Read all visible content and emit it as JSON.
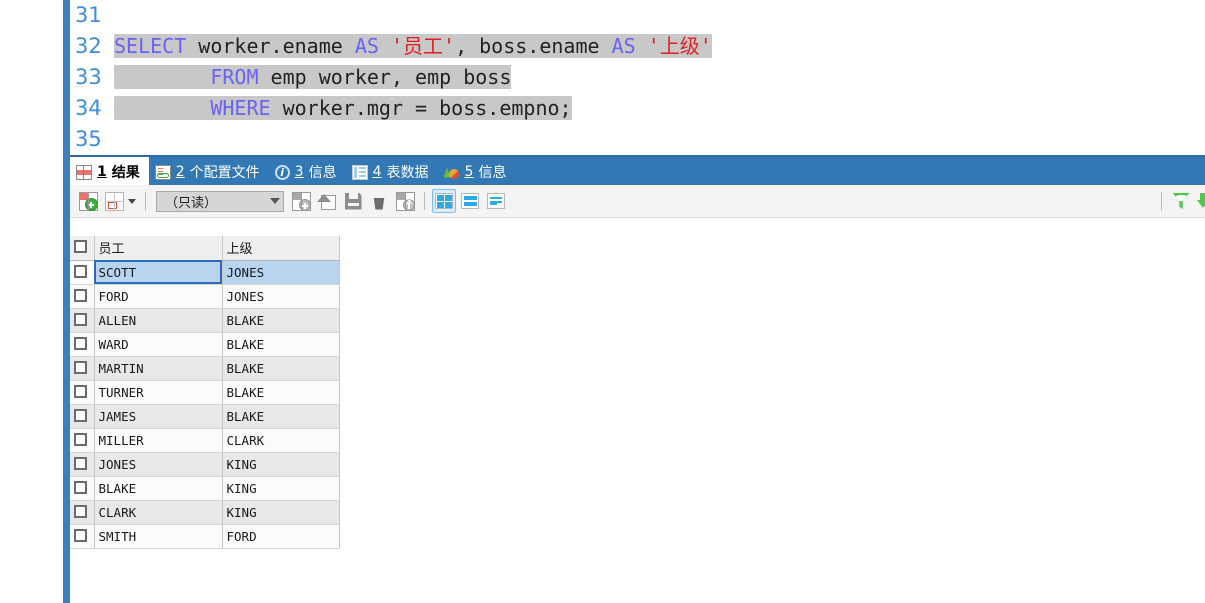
{
  "editor": {
    "line_numbers": [
      "31",
      "32",
      "33",
      "34",
      "35"
    ],
    "lines": [
      {
        "n": "31",
        "text": ""
      },
      {
        "n": "32",
        "text": "SELECT worker.ename AS '员工', boss.ename AS '上级'"
      },
      {
        "n": "33",
        "text": "        FROM emp worker, emp boss"
      },
      {
        "n": "34",
        "text": "        WHERE worker.mgr = boss.empno;"
      },
      {
        "n": "35",
        "text": ""
      }
    ],
    "tokens": {
      "select": "SELECT",
      "from": "FROM",
      "where": "WHERE",
      "as1": "AS",
      "as2": "AS",
      "worker_ename": " worker.ename ",
      "str1": "'员工'",
      "mid": ", boss.ename ",
      "str2": "'上级'",
      "from_rest": " emp worker, emp boss",
      "where_rest": " worker.mgr = boss.empno;",
      "indent": "        "
    },
    "colors": {
      "keyword": "#6a63f2",
      "string": "#e02020",
      "plain": "#222222",
      "selection_bg": "#c8c8c8",
      "line_number": "#3c8dde"
    }
  },
  "tabbar": {
    "background": "#3178b4",
    "tabs": [
      {
        "num": "1",
        "label": "结果",
        "icon": "results-grid-icon",
        "active": true
      },
      {
        "num": "2",
        "label": "个配置文件",
        "icon": "profile-icon",
        "active": false
      },
      {
        "num": "3",
        "label": "信息",
        "icon": "info-icon",
        "active": false
      },
      {
        "num": "4",
        "label": "表数据",
        "icon": "table-data-icon",
        "active": false
      },
      {
        "num": "5",
        "label": "信息",
        "icon": "chart-icon",
        "active": false
      }
    ]
  },
  "gridbar": {
    "readonly_value": "（只读）",
    "buttons": [
      {
        "name": "add-record-button",
        "icon": "grid-add-icon"
      },
      {
        "name": "grid-options-button",
        "icon": "grid-select-icon"
      },
      {
        "name": "insert-record-button",
        "icon": "grid-plus-icon"
      },
      {
        "name": "refresh-button",
        "icon": "refresh-icon"
      },
      {
        "name": "save-button",
        "icon": "floppy-icon"
      },
      {
        "name": "delete-button",
        "icon": "trash-icon"
      },
      {
        "name": "cancel-button",
        "icon": "grid-cancel-icon"
      },
      {
        "name": "view-grid-button",
        "icon": "view-grid-icon"
      },
      {
        "name": "view-form-button",
        "icon": "view-form-icon"
      },
      {
        "name": "view-text-button",
        "icon": "view-text-icon"
      },
      {
        "name": "filter-button",
        "icon": "funnel-icon"
      },
      {
        "name": "sort-button",
        "icon": "sort-descending-icon"
      }
    ]
  },
  "grid": {
    "columns": [
      "员工",
      "上级"
    ],
    "selected_column_index": 0,
    "selected_row_index": 0,
    "rows": [
      [
        "SCOTT",
        "JONES"
      ],
      [
        "FORD",
        "JONES"
      ],
      [
        "ALLEN",
        "BLAKE"
      ],
      [
        "WARD",
        "BLAKE"
      ],
      [
        "MARTIN",
        "BLAKE"
      ],
      [
        "TURNER",
        "BLAKE"
      ],
      [
        "JAMES",
        "BLAKE"
      ],
      [
        "MILLER",
        "CLARK"
      ],
      [
        "JONES",
        "KING"
      ],
      [
        "BLAKE",
        "KING"
      ],
      [
        "CLARK",
        "KING"
      ],
      [
        "SMITH",
        "FORD"
      ]
    ]
  },
  "colors": {
    "accent_blue": "#3178b4",
    "rail_blue": "#3c7ebf",
    "header_select_blue": "#3ca0ea",
    "row_select_blue": "#b9d4ef",
    "green": "#4ec94e"
  }
}
